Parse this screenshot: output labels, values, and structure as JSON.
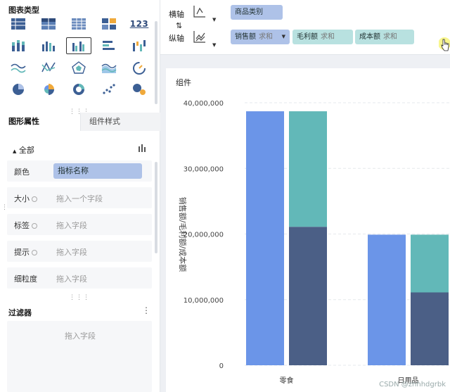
{
  "left_panel": {
    "chart_types_title": "图表类型",
    "chart_types": [
      {
        "icon": "table-icon",
        "selected": false
      },
      {
        "icon": "cross-table-icon",
        "selected": false
      },
      {
        "icon": "detail-table-icon",
        "selected": false
      },
      {
        "icon": "card-grid-icon",
        "selected": false
      },
      {
        "icon": "kpi-number-icon",
        "selected": false,
        "text": "123"
      },
      {
        "icon": "stacked-column-icon",
        "selected": false
      },
      {
        "icon": "column-chart-icon",
        "selected": false
      },
      {
        "icon": "grouped-column-icon",
        "selected": true
      },
      {
        "icon": "bar-chart-icon",
        "selected": false
      },
      {
        "icon": "waterfall-icon",
        "selected": false
      },
      {
        "icon": "line-chart-icon",
        "selected": false
      },
      {
        "icon": "combo-line-icon",
        "selected": false
      },
      {
        "icon": "radar-icon",
        "selected": false
      },
      {
        "icon": "area-chart-icon",
        "selected": false
      },
      {
        "icon": "gauge-icon",
        "selected": false
      },
      {
        "icon": "pie-chart-icon",
        "selected": false
      },
      {
        "icon": "rose-chart-icon",
        "selected": false
      },
      {
        "icon": "donut-chart-icon",
        "selected": false
      },
      {
        "icon": "scatter-icon",
        "selected": false
      },
      {
        "icon": "bubble-icon",
        "selected": false
      }
    ],
    "tabs": {
      "shape": "图形属性",
      "style": "组件样式"
    },
    "all_label": "全部",
    "properties": [
      {
        "label": "颜色",
        "value": "指标名称",
        "filled": true,
        "gear": false
      },
      {
        "label": "大小",
        "value": "拖入一个字段",
        "filled": false,
        "gear": true
      },
      {
        "label": "标签",
        "value": "拖入字段",
        "filled": false,
        "gear": true
      },
      {
        "label": "提示",
        "value": "拖入字段",
        "filled": false,
        "gear": true
      },
      {
        "label": "细粒度",
        "value": "拖入字段",
        "filled": false,
        "gear": false
      }
    ],
    "filter_title": "过滤器",
    "filter_more": "⋮",
    "filter_placeholder": "拖入字段"
  },
  "axis_bar": {
    "x_label": "横轴",
    "y_label": "纵轴",
    "swap_icon": "swap-axis-icon",
    "x_fields": [
      {
        "name": "商品类别"
      }
    ],
    "y_fields": [
      {
        "name": "销售额",
        "agg": "求和"
      },
      {
        "name": "毛利额",
        "agg": "求和"
      },
      {
        "name": "成本额",
        "agg": "求和"
      }
    ]
  },
  "colors": {
    "blue": "#6b95e8",
    "teal": "#62b8b8",
    "navy": "#4b5f86",
    "pill_blue": "#aec2e8",
    "pill_teal": "#b8e1e0"
  },
  "chart": {
    "component_title": "组件",
    "watermark": "CSDN @zhhhdgrbk"
  },
  "chart_data": {
    "type": "bar",
    "categories": [
      "零食",
      "日用品"
    ],
    "ylabel": "销售额/毛利额/成本额",
    "ylim": [
      0,
      40000000
    ],
    "yticks": [
      {
        "value": 0,
        "label": "0"
      },
      {
        "value": 10000000,
        "label": "10,000,000"
      },
      {
        "value": 20000000,
        "label": "20,000,000"
      },
      {
        "value": 30000000,
        "label": "30,000,000"
      },
      {
        "value": 40000000,
        "label": "40,000,000"
      }
    ],
    "series": [
      {
        "name": "销售额",
        "stack": "a",
        "color": "#6b95e8",
        "values": [
          38700000,
          19900000
        ]
      },
      {
        "name": "成本额",
        "stack": "b",
        "color": "#4b5f86",
        "values": [
          21100000,
          11100000
        ]
      },
      {
        "name": "毛利额",
        "stack": "b",
        "color": "#62b8b8",
        "values": [
          17600000,
          8800000
        ]
      }
    ]
  }
}
